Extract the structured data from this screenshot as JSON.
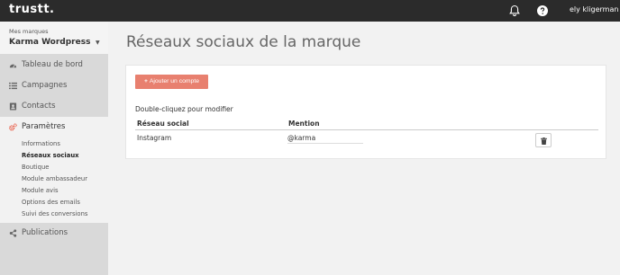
{
  "app": {
    "logo": "trustt."
  },
  "header": {
    "user_name": "ely kligerman",
    "icons": {
      "notifications": "bell-icon",
      "help": "question-circle-icon"
    }
  },
  "sidebar": {
    "brand_caption": "Mes marques",
    "brand_name": "Karma Wordpress",
    "items": [
      {
        "label": "Tableau de bord",
        "icon": "tachometer-icon"
      },
      {
        "label": "Campagnes",
        "icon": "list-icon"
      },
      {
        "label": "Contacts",
        "icon": "address-book-icon"
      },
      {
        "label": "Paramètres",
        "icon": "gears-icon"
      },
      {
        "label": "Publications",
        "icon": "share-icon"
      }
    ],
    "submenu": [
      "Informations",
      "Réseaux sociaux",
      "Boutique",
      "Module ambassadeur",
      "Module avis",
      "Options des emails",
      "Suivi des conversions"
    ],
    "active_item": "Paramètres",
    "current_subitem": "Réseaux sociaux"
  },
  "main": {
    "title": "Réseaux sociaux de la marque",
    "add_button": "Ajouter un compte",
    "hint": "Double-cliquez pour modifier",
    "table": {
      "headers": [
        "Réseau social",
        "Mention"
      ],
      "rows": [
        {
          "network": "Instagram",
          "mention": "@karma"
        }
      ]
    }
  },
  "colors": {
    "topbar": "#2b2b2b",
    "sidebar": "#d9d9d9",
    "accent": "#e8553f",
    "button": "#e8806f"
  }
}
